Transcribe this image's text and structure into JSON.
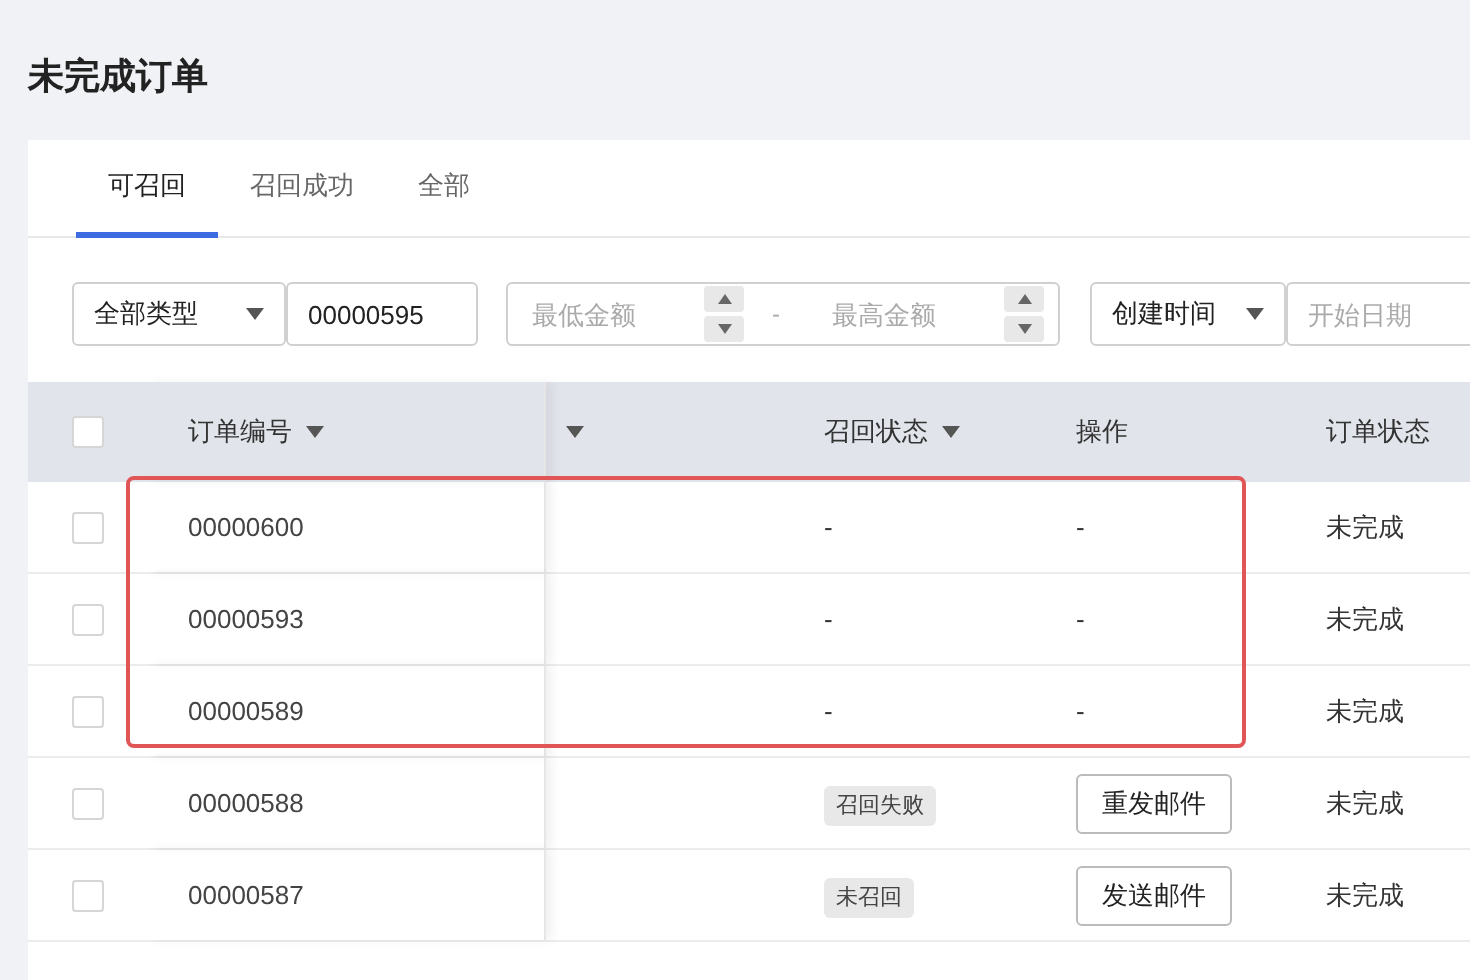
{
  "page_title": "未完成订单",
  "tabs": [
    {
      "label": "可召回",
      "selected": true
    },
    {
      "label": "召回成功",
      "selected": false
    },
    {
      "label": "全部",
      "selected": false
    }
  ],
  "filters": {
    "type_select": "全部类型",
    "order_no": "00000595",
    "min_amount": {
      "placeholder": "最低金额"
    },
    "range_separator": "-",
    "max_amount": {
      "placeholder": "最高金额"
    },
    "date_select": "创建时间",
    "start_date": {
      "placeholder": "开始日期"
    }
  },
  "table": {
    "select_all": {
      "checked": false
    },
    "columns": [
      {
        "label": "订单编号",
        "sortable": true
      },
      {
        "sortable": true
      },
      {
        "label": "召回状态",
        "sortable": true
      },
      {
        "label": "操作",
        "sortable": false
      },
      {
        "label": "订单状态",
        "sortable": false
      }
    ],
    "rows": [
      {
        "checked": false,
        "order_no": "00000600",
        "recall_status": {
          "kind": "text",
          "text": "-"
        },
        "action": {
          "kind": "text",
          "text": "-"
        },
        "order_status": "未完成",
        "highlighted": true
      },
      {
        "checked": false,
        "order_no": "00000593",
        "recall_status": {
          "kind": "text",
          "text": "-"
        },
        "action": {
          "kind": "text",
          "text": "-"
        },
        "order_status": "未完成",
        "highlighted": true
      },
      {
        "checked": false,
        "order_no": "00000589",
        "recall_status": {
          "kind": "text",
          "text": "-"
        },
        "action": {
          "kind": "text",
          "text": "-"
        },
        "order_status": "未完成",
        "highlighted": true
      },
      {
        "checked": false,
        "order_no": "00000588",
        "recall_status": {
          "kind": "tag",
          "text": "召回失败"
        },
        "action": {
          "kind": "button",
          "text": "重发邮件"
        },
        "order_status": "未完成",
        "highlighted": false
      },
      {
        "checked": false,
        "order_no": "00000587",
        "recall_status": {
          "kind": "tag",
          "text": "未召回"
        },
        "action": {
          "kind": "button",
          "text": "发送邮件"
        },
        "order_status": "未完成",
        "highlighted": false
      }
    ]
  }
}
